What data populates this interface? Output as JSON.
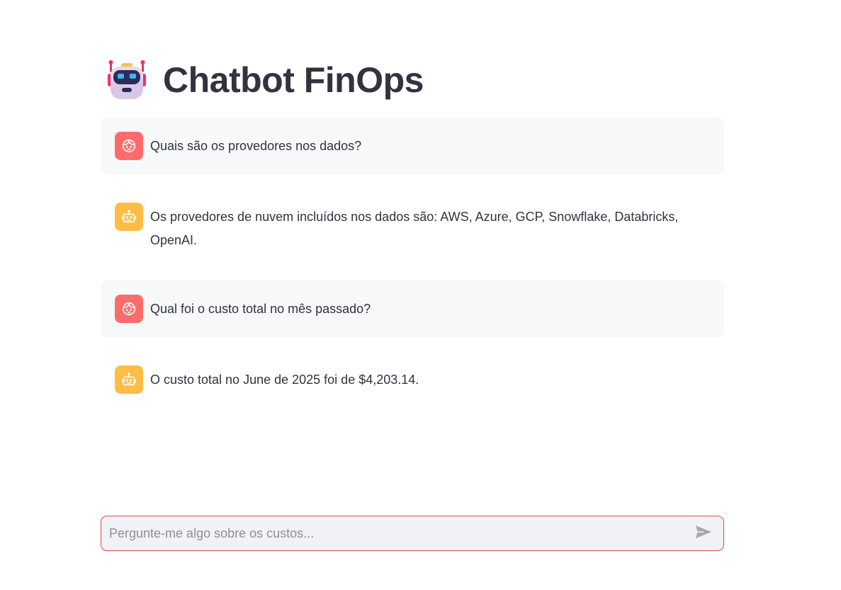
{
  "header": {
    "title": "Chatbot FinOps",
    "emoji": "robot-face-icon"
  },
  "messages": [
    {
      "role": "user",
      "avatar": "user-face-icon",
      "text": "Quais são os provedores nos dados?"
    },
    {
      "role": "assistant",
      "avatar": "bot-face-icon",
      "text": "Os provedores de nuvem incluídos nos dados são: AWS, Azure, GCP, Snowflake, Databricks, OpenAI."
    },
    {
      "role": "user",
      "avatar": "user-face-icon",
      "text": "Qual foi o custo total no mês passado?"
    },
    {
      "role": "assistant",
      "avatar": "bot-face-icon",
      "text": "O custo total no June de 2025 foi de $4,203.14."
    }
  ],
  "chat_input": {
    "placeholder": "Pergunte-me algo sobre os custos...",
    "value": "",
    "send_icon": "send-icon"
  },
  "colors": {
    "user_avatar": "#ff6b6b",
    "bot_avatar": "#ffbd45",
    "input_border": "#e0474f",
    "user_bubble": "#f7f8f9"
  }
}
